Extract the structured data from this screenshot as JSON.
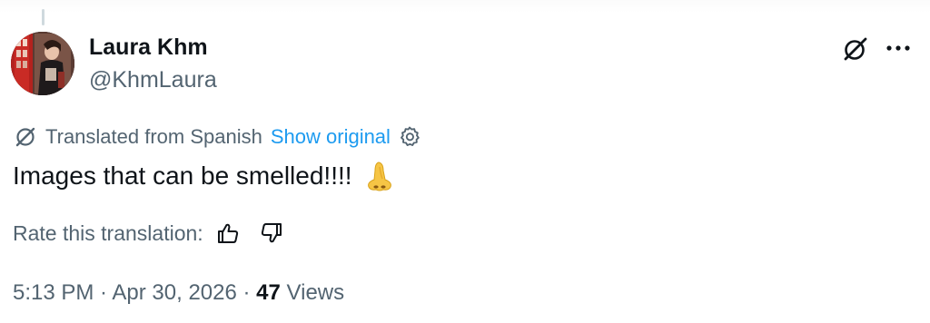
{
  "author": {
    "display_name": "Laura Khm",
    "handle": "@KhmLaura",
    "avatar": "avatar-photo"
  },
  "actions": {
    "grok_icon": "grok-slash-circle-icon",
    "more_icon": "ellipsis-icon"
  },
  "translation": {
    "icon": "translate-icon",
    "notice": "Translated from Spanish",
    "show_original_label": "Show original",
    "settings_icon": "gear-icon",
    "link_color": "#1d9bf0"
  },
  "tweet": {
    "text": "Images that can be smelled!!!!",
    "emoji": "nose-emoji"
  },
  "rating": {
    "label": "Rate this translation:",
    "thumbs_up_icon": "thumbs-up-icon",
    "thumbs_down_icon": "thumbs-down-icon"
  },
  "meta": {
    "time": "5:13 PM",
    "separator": " · ",
    "date": "Apr 30, 2026",
    "views_count": "47",
    "views_label": " Views"
  }
}
